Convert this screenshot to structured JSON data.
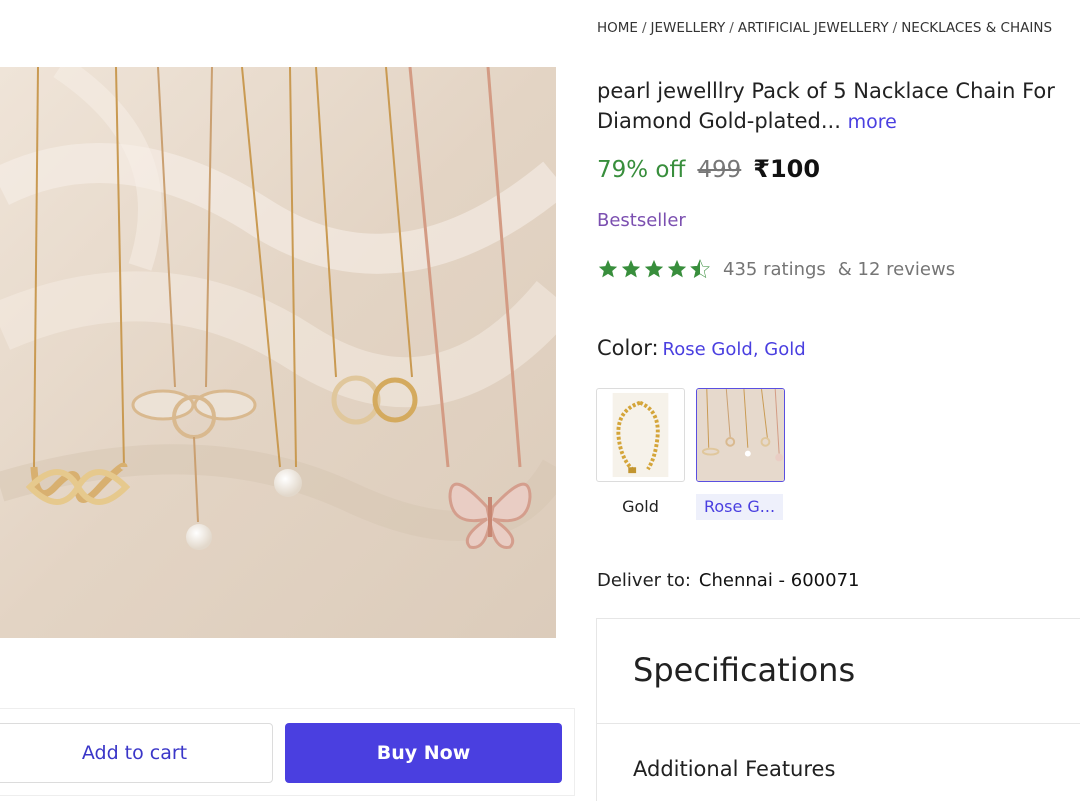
{
  "breadcrumb": [
    "HOME",
    "JEWELLERY",
    "ARTIFICIAL JEWELLERY",
    "NECKLACES & CHAINS"
  ],
  "product": {
    "title_line1": "pearl jewelllry Pack of 5 Nacklace Chain For",
    "title_line2": "Diamond Gold-plated...",
    "more_label": "more",
    "discount": "79% off",
    "mrp": "499",
    "price": "₹100",
    "badge": "Bestseller",
    "rating_value": 4.5,
    "ratings_text": "435 ratings",
    "reviews_text": "& 12 reviews"
  },
  "color": {
    "label": "Color:",
    "selected": "Rose Gold, Gold",
    "options": [
      {
        "label": "Gold",
        "selected": false
      },
      {
        "label": "Rose G...",
        "selected": true
      }
    ]
  },
  "delivery": {
    "label": "Deliver to:",
    "location": "Chennai - 600071"
  },
  "specs": {
    "title": "Specifications",
    "subheading": "Additional Features"
  },
  "actions": {
    "add_to_cart": "Add to cart",
    "buy_now": "Buy Now"
  },
  "colors": {
    "accent": "#4a3fe0",
    "discount_green": "#388e3c",
    "star_green": "#388e3c",
    "badge_purple": "#7b4fb0"
  }
}
